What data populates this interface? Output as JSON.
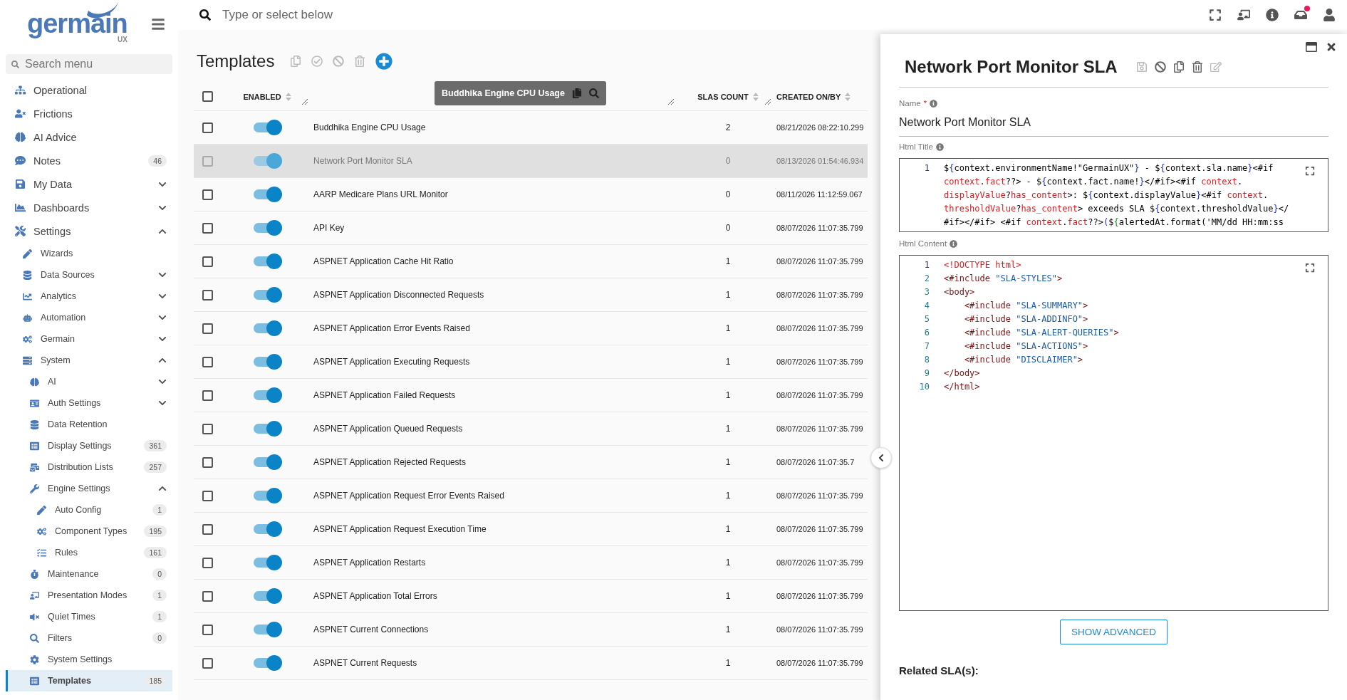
{
  "logo": {
    "name": "germain",
    "sub": "UX"
  },
  "sidebar": {
    "search_placeholder": "Search menu",
    "items": [
      {
        "label": "Operational",
        "selected": false
      },
      {
        "label": "Frictions",
        "selected": false
      },
      {
        "label": "AI Advice",
        "selected": false
      },
      {
        "label": "Notes",
        "badge": "46",
        "selected": false
      },
      {
        "label": "My Data",
        "expanded": false,
        "selected": false
      },
      {
        "label": "Dashboards",
        "expanded": false,
        "selected": false
      },
      {
        "label": "Settings",
        "expanded": true,
        "selected": false,
        "children": [
          {
            "label": "Wizards",
            "selected": false
          },
          {
            "label": "Data Sources",
            "expanded": false,
            "selected": false
          },
          {
            "label": "Analytics",
            "expanded": false,
            "selected": false
          },
          {
            "label": "Automation",
            "expanded": false,
            "selected": false
          },
          {
            "label": "Germain",
            "expanded": false,
            "selected": false
          },
          {
            "label": "System",
            "expanded": true,
            "selected": false,
            "children": [
              {
                "label": "AI",
                "expanded": false,
                "selected": false
              },
              {
                "label": "Auth Settings",
                "expanded": false,
                "selected": false
              },
              {
                "label": "Data Retention",
                "selected": false
              },
              {
                "label": "Display Settings",
                "badge": "361",
                "selected": false
              },
              {
                "label": "Distribution Lists",
                "badge": "257",
                "selected": false
              },
              {
                "label": "Engine Settings",
                "expanded": true,
                "selected": false,
                "children": [
                  {
                    "label": "Auto Config",
                    "badge": "1",
                    "selected": false
                  },
                  {
                    "label": "Component Types",
                    "badge": "195",
                    "selected": false
                  },
                  {
                    "label": "Rules",
                    "badge": "161",
                    "selected": false
                  }
                ]
              },
              {
                "label": "Maintenance",
                "badge": "0",
                "selected": false
              },
              {
                "label": "Presentation Modes",
                "badge": "1",
                "selected": false
              },
              {
                "label": "Quiet Times",
                "badge": "1",
                "selected": false
              },
              {
                "label": "Filters",
                "badge": "0",
                "selected": false
              },
              {
                "label": "System Settings",
                "selected": false
              },
              {
                "label": "Templates",
                "badge": "185",
                "selected": true
              }
            ]
          }
        ]
      }
    ]
  },
  "topbar": {
    "search_placeholder": "Type or select below",
    "notification": true
  },
  "page": {
    "title": "Templates"
  },
  "table": {
    "columns": [
      {
        "label": "ENABLED"
      },
      {
        "label": "SLAS COUNT"
      },
      {
        "label": "CREATED ON/BY"
      }
    ],
    "tooltip": "Buddhika Engine CPU Usage",
    "select_all_checked": false,
    "rows": [
      {
        "name": "Buddhika Engine CPU Usage",
        "slas": "2",
        "created": "08/21/2026 08:22:10.299",
        "enabled": true,
        "checked": false,
        "selected": false
      },
      {
        "name": "Network Port Monitor SLA",
        "slas": "0",
        "created": "08/13/2026 01:54:46.934",
        "enabled": true,
        "checked": false,
        "selected": true
      },
      {
        "name": "AARP Medicare Plans URL Monitor",
        "slas": "0",
        "created": "08/11/2026 11:12:59.067",
        "enabled": true,
        "checked": false,
        "selected": false
      },
      {
        "name": "API Key",
        "slas": "0",
        "created": "08/07/2026 11:07:35.799",
        "enabled": true,
        "checked": false,
        "selected": false
      },
      {
        "name": "ASPNET Application Cache Hit Ratio",
        "slas": "1",
        "created": "08/07/2026 11:07:35.799",
        "enabled": true,
        "checked": false,
        "selected": false
      },
      {
        "name": "ASPNET Application Disconnected Requests",
        "slas": "1",
        "created": "08/07/2026 11:07:35.799",
        "enabled": true,
        "checked": false,
        "selected": false
      },
      {
        "name": "ASPNET Application Error Events Raised",
        "slas": "1",
        "created": "08/07/2026 11:07:35.799",
        "enabled": true,
        "checked": false,
        "selected": false
      },
      {
        "name": "ASPNET Application Executing Requests",
        "slas": "1",
        "created": "08/07/2026 11:07:35.799",
        "enabled": true,
        "checked": false,
        "selected": false
      },
      {
        "name": "ASPNET Application Failed Requests",
        "slas": "1",
        "created": "08/07/2026 11:07:35.799",
        "enabled": true,
        "checked": false,
        "selected": false
      },
      {
        "name": "ASPNET Application Queued Requests",
        "slas": "1",
        "created": "08/07/2026 11:07:35.799",
        "enabled": true,
        "checked": false,
        "selected": false
      },
      {
        "name": "ASPNET Application Rejected Requests",
        "slas": "1",
        "created": "08/07/2026 11:07:35.7",
        "enabled": true,
        "checked": false,
        "selected": false
      },
      {
        "name": "ASPNET Application Request Error Events Raised",
        "slas": "1",
        "created": "08/07/2026 11:07:35.799",
        "enabled": true,
        "checked": false,
        "selected": false
      },
      {
        "name": "ASPNET Application Request Execution Time",
        "slas": "1",
        "created": "08/07/2026 11:07:35.799",
        "enabled": true,
        "checked": false,
        "selected": false
      },
      {
        "name": "ASPNET Application Restarts",
        "slas": "1",
        "created": "08/07/2026 11:07:35.799",
        "enabled": true,
        "checked": false,
        "selected": false
      },
      {
        "name": "ASPNET Application Total Errors",
        "slas": "1",
        "created": "08/07/2026 11:07:35.799",
        "enabled": true,
        "checked": false,
        "selected": false
      },
      {
        "name": "ASPNET Current Connections",
        "slas": "1",
        "created": "08/07/2026 11:07:35.799",
        "enabled": true,
        "checked": false,
        "selected": false
      },
      {
        "name": "ASPNET Current Requests",
        "slas": "1",
        "created": "08/07/2026 11:07:35.799",
        "enabled": true,
        "checked": false,
        "selected": false
      }
    ]
  },
  "panel": {
    "title": "Network Port Monitor SLA",
    "name_label": "Name",
    "required_mark": "*",
    "name_value": "Network Port Monitor SLA",
    "html_title_label": "Html Title",
    "html_title_line_number": "1",
    "html_title_code": [
      [
        {
          "text": "$",
          "kind": "plain"
        },
        {
          "text": "{",
          "kind": "brace"
        },
        {
          "text": "context.environmentName!\"GermainUX\"",
          "kind": "plain"
        },
        {
          "text": "}",
          "kind": "brace"
        },
        {
          "text": " - $",
          "kind": "plain"
        },
        {
          "text": "{",
          "kind": "brace"
        },
        {
          "text": "context.sla.name",
          "kind": "plain"
        },
        {
          "text": "}",
          "kind": "brace"
        },
        {
          "text": "<#if",
          "kind": "plain"
        }
      ],
      [
        {
          "text": "context",
          "kind": "keyword"
        },
        {
          "text": ".",
          "kind": "plain"
        },
        {
          "text": "fact",
          "kind": "keyword"
        },
        {
          "text": "??> - $",
          "kind": "plain"
        },
        {
          "text": "{",
          "kind": "brace"
        },
        {
          "text": "context.fact.name!",
          "kind": "plain"
        },
        {
          "text": "}",
          "kind": "brace"
        },
        {
          "text": "</#if><#if ",
          "kind": "plain"
        },
        {
          "text": "context",
          "kind": "keyword"
        },
        {
          "text": ".",
          "kind": "plain"
        }
      ],
      [
        {
          "text": "displayValue",
          "kind": "keyword"
        },
        {
          "text": "?",
          "kind": "plain"
        },
        {
          "text": "has_content",
          "kind": "keyword"
        },
        {
          "text": ">: $",
          "kind": "plain"
        },
        {
          "text": "{",
          "kind": "brace"
        },
        {
          "text": "context.displayValue",
          "kind": "plain"
        },
        {
          "text": "}",
          "kind": "brace"
        },
        {
          "text": "<#if ",
          "kind": "plain"
        },
        {
          "text": "context",
          "kind": "keyword"
        },
        {
          "text": ".",
          "kind": "plain"
        }
      ],
      [
        {
          "text": "thresholdValue",
          "kind": "keyword"
        },
        {
          "text": "?",
          "kind": "plain"
        },
        {
          "text": "has_content",
          "kind": "keyword"
        },
        {
          "text": "> exceeds SLA $",
          "kind": "plain"
        },
        {
          "text": "{",
          "kind": "brace"
        },
        {
          "text": "context.thresholdValue",
          "kind": "plain"
        },
        {
          "text": "}",
          "kind": "brace"
        },
        {
          "text": "</",
          "kind": "plain"
        }
      ],
      [
        {
          "text": "#if></#if> <#if ",
          "kind": "plain"
        },
        {
          "text": "context",
          "kind": "keyword"
        },
        {
          "text": ".",
          "kind": "plain"
        },
        {
          "text": "fact",
          "kind": "keyword"
        },
        {
          "text": "??>",
          "kind": "plain"
        },
        {
          "text": "(",
          "kind": "brace"
        },
        {
          "text": "$",
          "kind": "plain"
        },
        {
          "text": "{",
          "kind": "inner"
        },
        {
          "text": "alertedAt.format('MM/dd HH:mm:ss",
          "kind": "plain"
        }
      ]
    ],
    "html_content_label": "Html Content",
    "html_content_lines": [
      {
        "number": "1",
        "tokens": [
          {
            "text": "<!DOCTYPE html>",
            "kind": "keyword"
          }
        ]
      },
      {
        "number": "2",
        "tokens": [
          {
            "text": "<#include ",
            "kind": "tag"
          },
          {
            "text": "\"SLA-STYLES\"",
            "kind": "string"
          },
          {
            "text": ">",
            "kind": "tag"
          }
        ]
      },
      {
        "number": "3",
        "tokens": [
          {
            "text": "<body>",
            "kind": "tag"
          }
        ]
      },
      {
        "number": "4",
        "tokens": [
          {
            "text": "    <#include ",
            "kind": "tag"
          },
          {
            "text": "\"SLA-SUMMARY\"",
            "kind": "string"
          },
          {
            "text": ">",
            "kind": "tag"
          }
        ]
      },
      {
        "number": "5",
        "tokens": [
          {
            "text": "    <#include ",
            "kind": "tag"
          },
          {
            "text": "\"SLA-ADDINFO\"",
            "kind": "string"
          },
          {
            "text": ">",
            "kind": "tag"
          }
        ]
      },
      {
        "number": "6",
        "tokens": [
          {
            "text": "    <#include ",
            "kind": "tag"
          },
          {
            "text": "\"SLA-ALERT-QUERIES\"",
            "kind": "string"
          },
          {
            "text": ">",
            "kind": "tag"
          }
        ]
      },
      {
        "number": "7",
        "tokens": [
          {
            "text": "    <#include ",
            "kind": "tag"
          },
          {
            "text": "\"SLA-ACTIONS\"",
            "kind": "string"
          },
          {
            "text": ">",
            "kind": "tag"
          }
        ]
      },
      {
        "number": "8",
        "tokens": [
          {
            "text": "    <#include ",
            "kind": "tag"
          },
          {
            "text": "\"DISCLAIMER\"",
            "kind": "string"
          },
          {
            "text": ">",
            "kind": "tag"
          }
        ]
      },
      {
        "number": "9",
        "tokens": [
          {
            "text": "</body>",
            "kind": "tag"
          }
        ]
      },
      {
        "number": "10",
        "tokens": [
          {
            "text": "</html>",
            "kind": "tag"
          }
        ]
      }
    ],
    "show_advanced": "SHOW ADVANCED",
    "related_label": "Related SLA(s):"
  }
}
